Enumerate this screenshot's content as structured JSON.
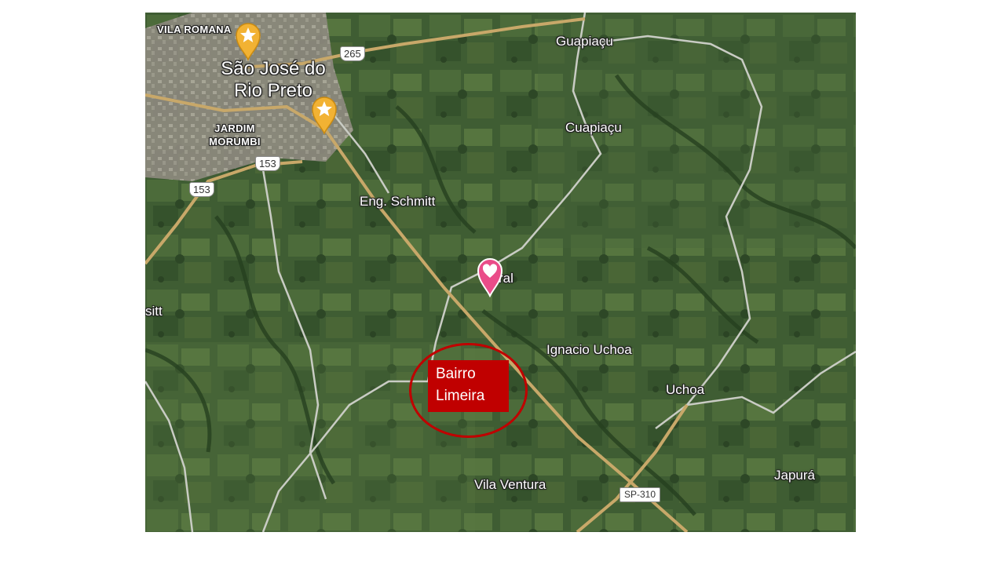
{
  "map": {
    "type": "satellite",
    "colors": {
      "land": "#3d5a32",
      "road_minor": "#c9ccc4",
      "road_major": "#c8a869",
      "urban": "#8f8a80"
    },
    "labels": {
      "vila_romana": "VILA ROMANA",
      "sao_jose": "São José do\nRio Preto",
      "jardim_morumbi": "JARDIM\nMORUMBI",
      "guapiacu": "Guapiaçu",
      "cuapiacu": "Cuapiaçu",
      "eng_schmitt": "Eng. Schmitt",
      "cedral": "ral",
      "sitt": "sitt",
      "ignacio_uchoa": "Ignacio Uchoa",
      "uchoa": "Uchoa",
      "vila_ventura": "Vila Ventura",
      "japura": "Japurá"
    },
    "road_shields": {
      "r265": "265",
      "r153_a": "153",
      "r153_b": "153",
      "sp310": "SP-310"
    },
    "markers": [
      {
        "icon": "star-pin-icon",
        "color": "#f2b233"
      },
      {
        "icon": "star-pin-icon",
        "color": "#f2b233"
      },
      {
        "icon": "heart-pin-icon",
        "color": "#ea4c89"
      }
    ]
  },
  "callout": {
    "line1": "Bairro",
    "line2": "Limeira",
    "color": "#c00000"
  }
}
